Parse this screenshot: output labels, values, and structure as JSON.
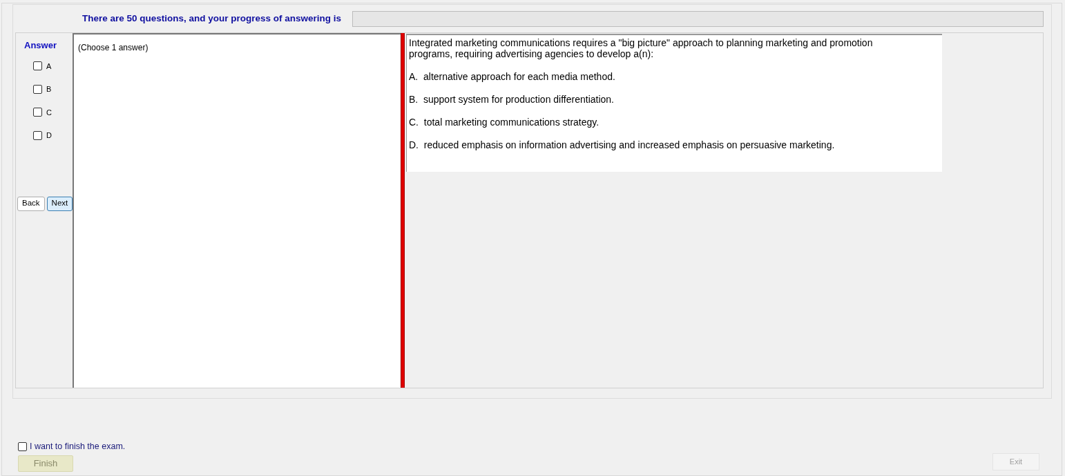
{
  "header": {
    "text": "There are 50 questions, and your progress of answering is",
    "progress": {
      "level": 0
    }
  },
  "answer_panel": {
    "title": "Answer",
    "options": [
      {
        "label": "A",
        "checked": false
      },
      {
        "label": "B",
        "checked": false
      },
      {
        "label": "C",
        "checked": false
      },
      {
        "label": "D",
        "checked": false
      }
    ]
  },
  "navigation": [
    {
      "label": "Back",
      "focused": false
    },
    {
      "label": "Next",
      "focused": true
    }
  ],
  "choose_hint": "(Choose 1 answer)",
  "question": {
    "text": "Integrated marketing communications requires a \"big picture\" approach to planning marketing and promotion programs, requiring advertising agencies to develop a(n):",
    "options": [
      "A.  alternative approach for each media method.",
      "B.  support system for production differentiation.",
      "C.  total marketing communications strategy.",
      "D.  reduced emphasis on information advertising and increased emphasis on persuasive marketing."
    ]
  },
  "finish": {
    "confirm_label": "I want to finish the exam.",
    "checked": false,
    "button": {
      "label": "Finish",
      "disabled": true
    }
  },
  "exit": {
    "label": "Exit",
    "disabled": true
  }
}
